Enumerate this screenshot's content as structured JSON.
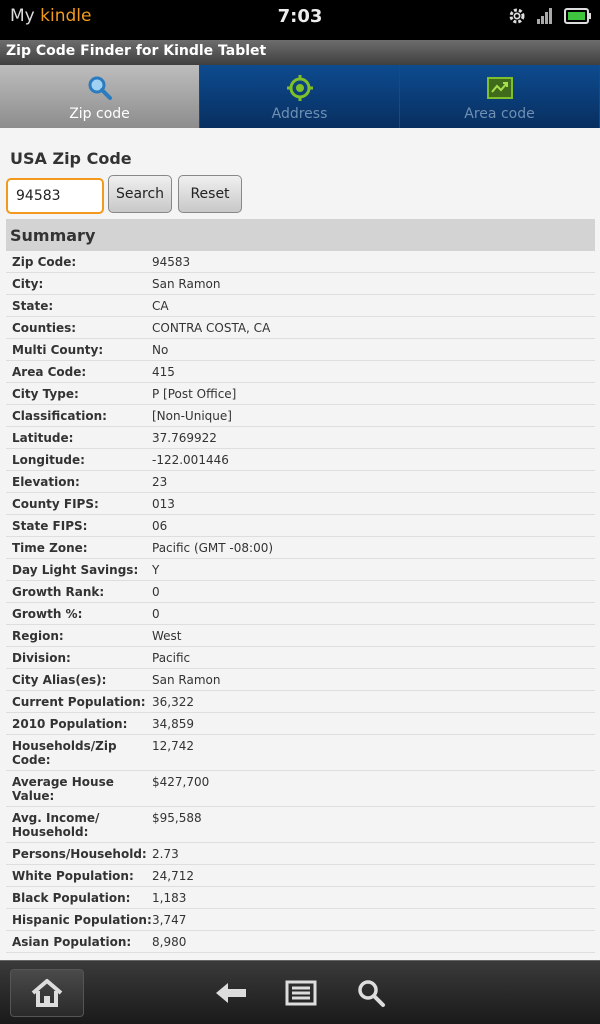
{
  "status_bar": {
    "brand_my": "My",
    "brand_kindle": "kindle",
    "time": "7:03",
    "icons": [
      "gear-icon",
      "signal-icon",
      "battery-icon"
    ]
  },
  "app_title": "Zip Code Finder for Kindle Tablet",
  "tabs": [
    {
      "label": "Zip code",
      "icon": "magnifier-icon",
      "active": true
    },
    {
      "label": "Address",
      "icon": "target-icon",
      "active": false
    },
    {
      "label": "Area code",
      "icon": "map-icon",
      "active": false
    }
  ],
  "form": {
    "heading": "USA Zip Code",
    "zip_value": "94583",
    "search_label": "Search",
    "reset_label": "Reset"
  },
  "summary": {
    "title": "Summary",
    "rows": [
      {
        "label": "Zip Code:",
        "value": "94583"
      },
      {
        "label": "City:",
        "value": "San Ramon"
      },
      {
        "label": "State:",
        "value": "CA"
      },
      {
        "label": "Counties:",
        "value": "CONTRA COSTA, CA"
      },
      {
        "label": "Multi County:",
        "value": "No"
      },
      {
        "label": "Area Code:",
        "value": "415"
      },
      {
        "label": "City Type:",
        "value": "P [Post Office]"
      },
      {
        "label": "Classification:",
        "value": "[Non-Unique]"
      },
      {
        "label": "Latitude:",
        "value": "37.769922"
      },
      {
        "label": "Longitude:",
        "value": "-122.001446"
      },
      {
        "label": "Elevation:",
        "value": "23"
      },
      {
        "label": "County FIPS:",
        "value": "013"
      },
      {
        "label": "State FIPS:",
        "value": "06"
      },
      {
        "label": "Time Zone:",
        "value": "Pacific (GMT -08:00)"
      },
      {
        "label": "Day Light Savings:",
        "value": "Y"
      },
      {
        "label": "Growth Rank:",
        "value": "0"
      },
      {
        "label": "Growth %:",
        "value": "0"
      },
      {
        "label": "Region:",
        "value": "West"
      },
      {
        "label": "Division:",
        "value": "Pacific"
      },
      {
        "label": "City Alias(es):",
        "value": "San Ramon"
      },
      {
        "label": "Current Population:",
        "value": "36,322"
      },
      {
        "label": "2010 Population:",
        "value": "34,859"
      },
      {
        "label": "Households/Zip Code:",
        "value": "12,742"
      },
      {
        "label": "Average House Value:",
        "value": "$427,700"
      },
      {
        "label": "Avg. Income/ Household:",
        "value": "$95,588"
      },
      {
        "label": "Persons/Household:",
        "value": "2.73"
      },
      {
        "label": "White Population:",
        "value": "24,712"
      },
      {
        "label": "Black Population:",
        "value": "1,183"
      },
      {
        "label": "Hispanic Population:",
        "value": "3,747"
      },
      {
        "label": "Asian Population:",
        "value": "8,980"
      }
    ]
  },
  "nav": {
    "icons": [
      "home-icon",
      "back-icon",
      "menu-icon",
      "search-icon"
    ]
  },
  "colors": {
    "accent_orange": "#f39a1e",
    "tab_blue": "#0a3c74"
  }
}
